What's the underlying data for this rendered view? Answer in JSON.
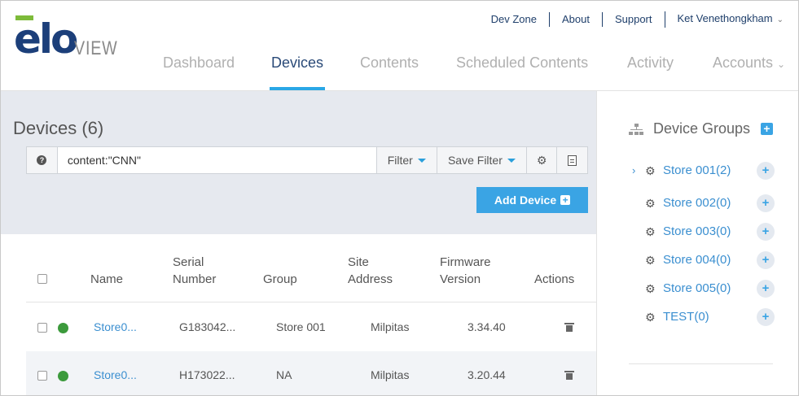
{
  "brand": {
    "logo_word": "elo",
    "logo_sub": "VIEW"
  },
  "toplinks": [
    {
      "label": "Dev Zone"
    },
    {
      "label": "About"
    },
    {
      "label": "Support"
    },
    {
      "label": "Ket Venethongkham"
    }
  ],
  "nav": [
    {
      "label": "Dashboard",
      "active": false
    },
    {
      "label": "Devices",
      "active": true
    },
    {
      "label": "Contents",
      "active": false
    },
    {
      "label": "Scheduled Contents",
      "active": false
    },
    {
      "label": "Activity",
      "active": false
    },
    {
      "label": "Accounts",
      "active": false
    }
  ],
  "devices": {
    "title": "Devices (6)",
    "search_value": "content:\"CNN\"",
    "filter_label": "Filter",
    "save_filter_label": "Save Filter",
    "add_device_label": "Add Device"
  },
  "table": {
    "headers": {
      "name": "Name",
      "serial_line1": "Serial",
      "serial_line2": "Number",
      "group": "Group",
      "site_line1": "Site",
      "site_line2": "Address",
      "fw_line1": "Firmware",
      "fw_line2": "Version",
      "actions": "Actions"
    },
    "rows": [
      {
        "name": "Store0...",
        "serial": "G183042...",
        "group": "Store 001",
        "site": "Milpitas",
        "firmware": "3.34.40",
        "status": "online"
      },
      {
        "name": "Store0...",
        "serial": "H173022...",
        "group": "NA",
        "site": "Milpitas",
        "firmware": "3.20.44",
        "status": "online"
      }
    ]
  },
  "device_groups": {
    "title": "Device Groups",
    "items": [
      {
        "label": "Store 001(2)",
        "expandable": true
      },
      {
        "label": "Store 002(0)",
        "expandable": false
      },
      {
        "label": "Store 003(0)",
        "expandable": false
      },
      {
        "label": "Store 004(0)",
        "expandable": false
      },
      {
        "label": "Store 005(0)",
        "expandable": false
      },
      {
        "label": "TEST(0)",
        "expandable": false
      }
    ]
  },
  "colors": {
    "brand_navy": "#1c3f7a",
    "brand_green": "#7dbb3a",
    "accent_blue": "#3aa4e4",
    "link_blue": "#3b8fd0",
    "status_online": "#3c9a3c",
    "header_bg": "#e6e9ef"
  }
}
